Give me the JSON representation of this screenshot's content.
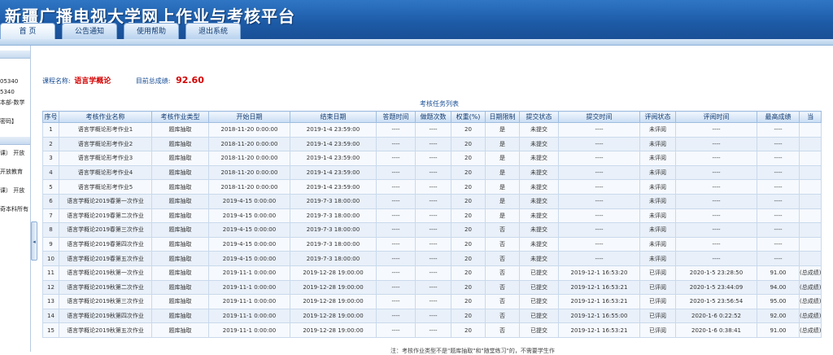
{
  "header": {
    "title": "新疆广播电视大学网上作业与考核平台"
  },
  "nav": [
    "首 页",
    "公告通知",
    "使用帮助",
    "退出系统"
  ],
  "sidebar": {
    "lines": [
      "05340",
      "5340",
      "本部-数学",
      "密码】",
      "课）  开放",
      "  开放教育",
      "课）  开放",
      "奇本科所有"
    ]
  },
  "course": {
    "name_label": "课程名称:",
    "name": "语言学概论",
    "score_label": "目前总成绩:",
    "score": "92.60"
  },
  "table": {
    "caption": "考核任务列表",
    "headers": [
      "序号",
      "考核作业名称",
      "考核作业类型",
      "开始日期",
      "结束日期",
      "答题时间",
      "做题次数",
      "权重(%)",
      "日期限制",
      "提交状态",
      "提交时间",
      "评阅状态",
      "评阅时间",
      "最高成绩",
      "当"
    ],
    "rows": [
      [
        "1",
        "语言学概论形考作业1",
        "题库抽取",
        "2018-11-20 0:00:00",
        "2019-1-4 23:59:00",
        "----",
        "----",
        "20",
        "是",
        "未提交",
        "----",
        "未评阅",
        "----",
        "----",
        ""
      ],
      [
        "2",
        "语言学概论形考作业2",
        "题库抽取",
        "2018-11-20 0:00:00",
        "2019-1-4 23:59:00",
        "----",
        "----",
        "20",
        "是",
        "未提交",
        "----",
        "未评阅",
        "----",
        "----",
        ""
      ],
      [
        "3",
        "语言学概论形考作业3",
        "题库抽取",
        "2018-11-20 0:00:00",
        "2019-1-4 23:59:00",
        "----",
        "----",
        "20",
        "是",
        "未提交",
        "----",
        "未评阅",
        "----",
        "----",
        ""
      ],
      [
        "4",
        "语言学概论形考作业4",
        "题库抽取",
        "2018-11-20 0:00:00",
        "2019-1-4 23:59:00",
        "----",
        "----",
        "20",
        "是",
        "未提交",
        "----",
        "未评阅",
        "----",
        "----",
        ""
      ],
      [
        "5",
        "语言学概论形考作业5",
        "题库抽取",
        "2018-11-20 0:00:00",
        "2019-1-4 23:59:00",
        "----",
        "----",
        "20",
        "是",
        "未提交",
        "----",
        "未评阅",
        "----",
        "----",
        ""
      ],
      [
        "6",
        "语言学概论2019春第一次作业",
        "题库抽取",
        "2019-4-15 0:00:00",
        "2019-7-3 18:00:00",
        "----",
        "----",
        "20",
        "是",
        "未提交",
        "----",
        "未评阅",
        "----",
        "----",
        ""
      ],
      [
        "7",
        "语言学概论2019春第二次作业",
        "题库抽取",
        "2019-4-15 0:00:00",
        "2019-7-3 18:00:00",
        "----",
        "----",
        "20",
        "是",
        "未提交",
        "----",
        "未评阅",
        "----",
        "----",
        ""
      ],
      [
        "8",
        "语言学概论2019春第三次作业",
        "题库抽取",
        "2019-4-15 0:00:00",
        "2019-7-3 18:00:00",
        "----",
        "----",
        "20",
        "否",
        "未提交",
        "----",
        "未评阅",
        "----",
        "----",
        ""
      ],
      [
        "9",
        "语言学概论2019春第四次作业",
        "题库抽取",
        "2019-4-15 0:00:00",
        "2019-7-3 18:00:00",
        "----",
        "----",
        "20",
        "否",
        "未提交",
        "----",
        "未评阅",
        "----",
        "----",
        ""
      ],
      [
        "10",
        "语言学概论2019春第五次作业",
        "题库抽取",
        "2019-4-15 0:00:00",
        "2019-7-3 18:00:00",
        "----",
        "----",
        "20",
        "否",
        "未提交",
        "----",
        "未评阅",
        "----",
        "----",
        ""
      ],
      [
        "11",
        "语言学概论2019秋第一次作业",
        "题库抽取",
        "2019-11-1 0:00:00",
        "2019-12-28 19:00:00",
        "----",
        "----",
        "20",
        "否",
        "已提交",
        "2019-12-1 16:53:20",
        "已评阅",
        "2020-1-5 23:28:50",
        "91.00",
        "(总成绩)"
      ],
      [
        "12",
        "语言学概论2019秋第二次作业",
        "题库抽取",
        "2019-11-1 0:00:00",
        "2019-12-28 19:00:00",
        "----",
        "----",
        "20",
        "否",
        "已提交",
        "2019-12-1 16:53:21",
        "已评阅",
        "2020-1-5 23:44:09",
        "94.00",
        "(总成绩)"
      ],
      [
        "13",
        "语言学概论2019秋第三次作业",
        "题库抽取",
        "2019-11-1 0:00:00",
        "2019-12-28 19:00:00",
        "----",
        "----",
        "20",
        "否",
        "已提交",
        "2019-12-1 16:53:21",
        "已评阅",
        "2020-1-5 23:56:54",
        "95.00",
        "(总成绩)"
      ],
      [
        "14",
        "语言学概论2019秋第四次作业",
        "题库抽取",
        "2019-11-1 0:00:00",
        "2019-12-28 19:00:00",
        "----",
        "----",
        "20",
        "否",
        "已提交",
        "2019-12-1 16:55:00",
        "已评阅",
        "2020-1-6 0:22:52",
        "92.00",
        "(总成绩)"
      ],
      [
        "15",
        "语言学概论2019秋第五次作业",
        "题库抽取",
        "2019-11-1 0:00:00",
        "2019-12-28 19:00:00",
        "----",
        "----",
        "20",
        "否",
        "已提交",
        "2019-12-1 16:53:21",
        "已评阅",
        "2020-1-6 0:38:41",
        "91.00",
        "(总成绩)"
      ]
    ]
  },
  "footer_note": "注：考核作业类型不是\"题库抽取\"和\"随堂练习\"的，不需要学生作"
}
